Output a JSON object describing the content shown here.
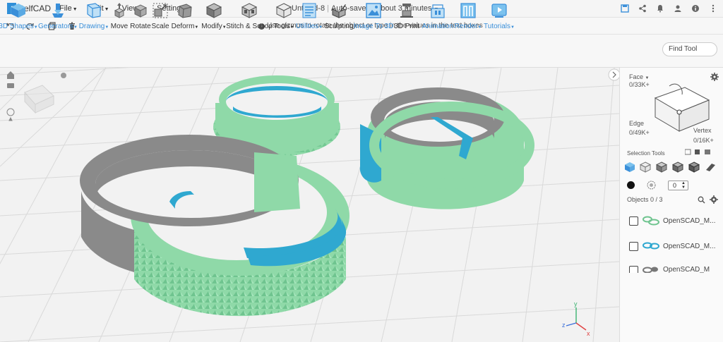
{
  "app": {
    "name": "SelfCAD"
  },
  "menu": [
    {
      "label": "File"
    },
    {
      "label": "Edit"
    },
    {
      "label": "View"
    },
    {
      "label": "Settings"
    }
  ],
  "document": {
    "title": "Untitled-8",
    "autosave": "Auto-save in about 3 minutes"
  },
  "hint": {
    "text": "Use gizmos to rotate the object or type in the values in the text boxes"
  },
  "tools": [
    {
      "label": "3D Shapes",
      "dropdown": true,
      "blue": true
    },
    {
      "label": "Generators",
      "dropdown": true,
      "blue": true
    },
    {
      "label": "Drawing",
      "dropdown": true,
      "blue": true
    },
    {
      "label": "Move",
      "dropdown": false,
      "blue": false
    },
    {
      "label": "Rotate",
      "dropdown": false,
      "blue": false
    },
    {
      "label": "Scale",
      "dropdown": false,
      "blue": false
    },
    {
      "label": "Deform",
      "dropdown": true,
      "blue": false
    },
    {
      "label": "Modify",
      "dropdown": true,
      "blue": false
    },
    {
      "label": "Stitch & Scoop",
      "dropdown": false,
      "blue": false
    },
    {
      "label": "Tools",
      "dropdown": true,
      "blue": false
    },
    {
      "label": "Utilities",
      "dropdown": true,
      "blue": true
    },
    {
      "label": "Sculpting",
      "dropdown": false,
      "blue": false
    },
    {
      "label": "Image To 3D",
      "dropdown": false,
      "blue": true
    },
    {
      "label": "3D Print",
      "dropdown": false,
      "blue": false
    },
    {
      "label": "Animation",
      "dropdown": false,
      "blue": true
    },
    {
      "label": "Render",
      "dropdown": true,
      "blue": true
    },
    {
      "label": "Tutorials",
      "dropdown": true,
      "blue": true
    }
  ],
  "find_tool": {
    "label": "Find Tool"
  },
  "right_panel": {
    "face_label": "Face",
    "face_count": "0/33K+",
    "edge_label": "Edge",
    "edge_count": "0/49K+",
    "vertex_label": "Vertex",
    "vertex_count": "0/16K+",
    "selection_tools_label": "Selection Tools",
    "brush_size": "0",
    "objects_label": "Objects 0 / 3",
    "objects": [
      {
        "name": "OpenSCAD_M..."
      },
      {
        "name": "OpenSCAD_M..."
      },
      {
        "name": "OpenSCAD_M"
      }
    ]
  },
  "colors": {
    "accent": "#3a8fd9",
    "model_green": "#8fd9a8",
    "model_gray": "#8a8a8a",
    "model_blue": "#2fa8d0"
  },
  "axis": {
    "x": "x",
    "y": "y",
    "z": "z"
  }
}
